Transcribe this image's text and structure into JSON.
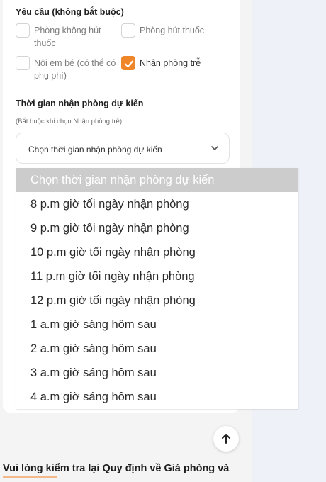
{
  "requests": {
    "title": "Yêu cầu (không bắt buộc)",
    "options": [
      {
        "label": "Phòng không hút thuốc",
        "checked": false
      },
      {
        "label": "Phòng hút thuốc",
        "checked": false
      },
      {
        "label": "Nôi em bé (có thể có phụ phí)",
        "checked": false
      },
      {
        "label": "Nhận phòng trễ",
        "checked": true
      }
    ]
  },
  "checkin": {
    "title": "Thời gian nhận phòng dự kiến",
    "hint": "(Bắt buộc khi chọn Nhận phòng trễ)",
    "select_value": "Chọn thời gian nhận phòng dự kiến",
    "options": [
      "Chọn thời gian nhận phòng dự kiến",
      "8 p.m giờ tối ngày nhận phòng",
      "9 p.m giờ tối ngày nhận phòng",
      "10 p.m giờ tối ngày nhận phòng",
      "11 p.m giờ tối ngày nhận phòng",
      "12 p.m giờ tối ngày nhận phòng",
      "1 a.m giờ sáng hôm sau",
      "2 a.m giờ sáng hôm sau",
      "3 a.m giờ sáng hôm sau",
      "4 a.m giờ sáng hôm sau"
    ]
  },
  "footer": {
    "notice": "Vui lòng kiểm tra lại Quy định về Giá phòng và",
    "scroll_top_icon": "arrow-up-icon"
  },
  "colors": {
    "accent": "#f0862a",
    "selected_option_bg": "#cccccc"
  }
}
